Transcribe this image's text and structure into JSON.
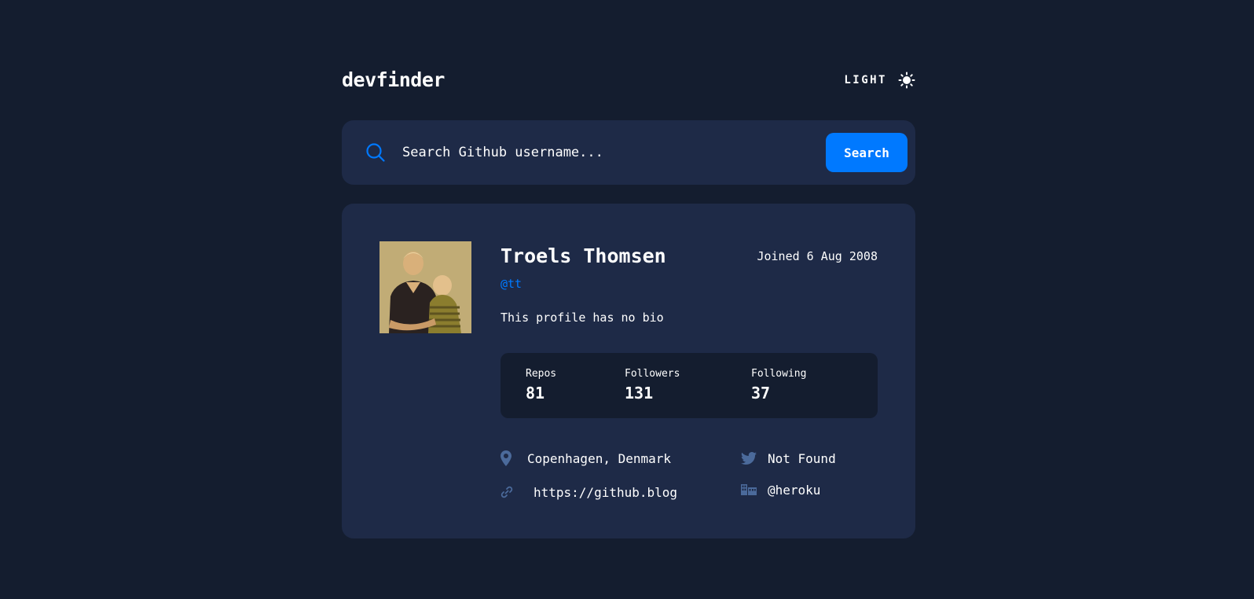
{
  "header": {
    "logo": "devfinder",
    "theme_toggle_label": "LIGHT",
    "theme_icon": "sun-icon"
  },
  "search": {
    "placeholder": "Search Github username...",
    "value": "",
    "button_label": "Search",
    "icon": "search-icon"
  },
  "profile": {
    "name": "Troels Thomsen",
    "login": "@tt",
    "joined": "Joined 6 Aug 2008",
    "bio": "This profile has no bio",
    "avatar_alt": "Troels Thomsen avatar",
    "stats": [
      {
        "label": "Repos",
        "value": "81"
      },
      {
        "label": "Followers",
        "value": "131"
      },
      {
        "label": "Following",
        "value": "37"
      }
    ],
    "links": {
      "location": "Copenhagen, Denmark",
      "blog": "https://github.blog",
      "twitter": "Not Found",
      "company": "@heroku"
    }
  },
  "colors": {
    "background": "#141d2f",
    "card": "#1e2a47",
    "accent": "#0079ff",
    "icon_muted": "#4b6a9b",
    "text": "#ffffff"
  }
}
